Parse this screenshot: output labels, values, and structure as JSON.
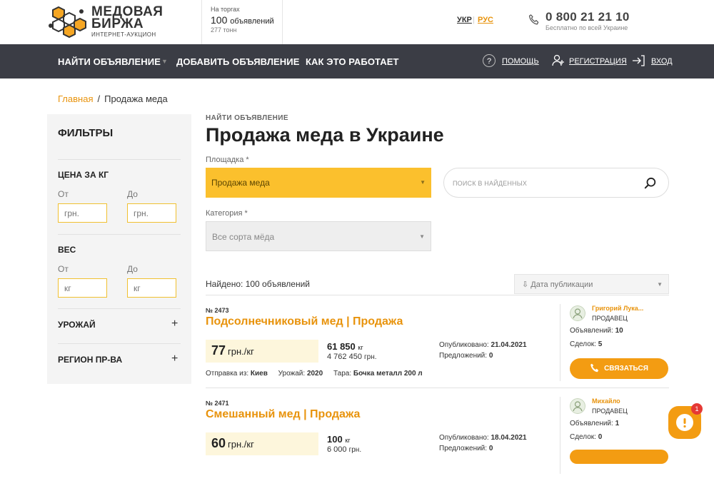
{
  "header": {
    "logo_line1": "МЕДОВАЯ",
    "logo_line2": "БИРЖА",
    "logo_tagline": "ИНТЕРНЕТ-АУКЦИОН",
    "auction_label": "На торгах",
    "auction_count": "100",
    "auction_count_unit": "объявлений",
    "auction_tons": "277 тонн",
    "lang_ukr": "УКР",
    "lang_sep": "|",
    "lang_rus": "РУС",
    "phone": "0 800 21 21 10",
    "phone_note": "Бесплатно по всей Украине"
  },
  "nav": {
    "find": "НАЙТИ ОБЪЯВЛЕНИЕ",
    "add": "ДОБАВИТЬ ОБЪЯВЛЕНИЕ",
    "how": "КАК ЭТО РАБОТАЕТ",
    "help": "ПОМОЩЬ",
    "register": "РЕГИСТРАЦИЯ",
    "login": "ВХОД"
  },
  "breadcrumb": {
    "home": "Главная",
    "sep": "/",
    "current": "Продажа меда"
  },
  "filters": {
    "title": "ФИЛЬТРЫ",
    "price_title": "ЦЕНА ЗА КГ",
    "from": "От",
    "to": "До",
    "price_placeholder": "грн.",
    "weight_title": "ВЕС",
    "weight_placeholder": "кг",
    "harvest_title": "УРОЖАЙ",
    "region_title": "РЕГИОН ПР-ВА",
    "plus": "+"
  },
  "main": {
    "overline": "НАЙТИ ОБЪЯВЛЕНИЕ",
    "title": "Продажа меда в Украине",
    "platform_label": "Площадка *",
    "platform_value": "Продажа меда",
    "category_label": "Категория *",
    "category_value": "Все сорта мёда",
    "search_placeholder": "ПОИСК В НАЙДЕННЫХ",
    "found": "Найдено: 100 объявлений",
    "sort_value": "Дата публикации",
    "sort_arrow": "⇩"
  },
  "listings": [
    {
      "number": "№ 2473",
      "title": "Подсолнечниковый мед | Продажа",
      "price": "77",
      "price_unit": "грн./кг",
      "weight": "61 850",
      "weight_unit": "кг",
      "total": "4 762 450",
      "total_unit": "грн.",
      "published_label": "Опубликовано:",
      "published": "21.04.2021",
      "offers_label": "Предложений:",
      "offers": "0",
      "ship_label": "Отправка из:",
      "ship": "Киев",
      "harvest_label": "Урожай:",
      "harvest": "2020",
      "pack_label": "Тара:",
      "pack": "Бочка металл 200 л",
      "seller": "Григорий Лука...",
      "role": "ПРОДАВЕЦ",
      "ads_label": "Объявлений:",
      "ads": "10",
      "deals_label": "Сделок:",
      "deals": "5",
      "contact": "СВЯЗАТЬСЯ"
    },
    {
      "number": "№ 2471",
      "title": "Смешанный мед | Продажа",
      "price": "60",
      "price_unit": "грн./кг",
      "weight": "100",
      "weight_unit": "кг",
      "total": "6 000",
      "total_unit": "грн.",
      "published_label": "Опубликовано:",
      "published": "18.04.2021",
      "offers_label": "Предложений:",
      "offers": "0",
      "seller": "Михайло",
      "role": "ПРОДАВЕЦ",
      "ads_label": "Объявлений:",
      "ads": "1",
      "deals_label": "Сделок:",
      "deals": "0"
    }
  ],
  "chat": {
    "badge": "1"
  },
  "icons": [
    "logo-honeycomb-icon",
    "phone-icon",
    "help-icon",
    "add-user-icon",
    "login-arrow-icon",
    "search-icon",
    "avatar-icon",
    "phone-call-icon",
    "chat-icon"
  ],
  "colors": {
    "accent": "#e8930c",
    "button": "#f39c12",
    "select": "#fbc02d",
    "navbar": "#3b3d45",
    "sidebar": "#f4f4f4"
  }
}
